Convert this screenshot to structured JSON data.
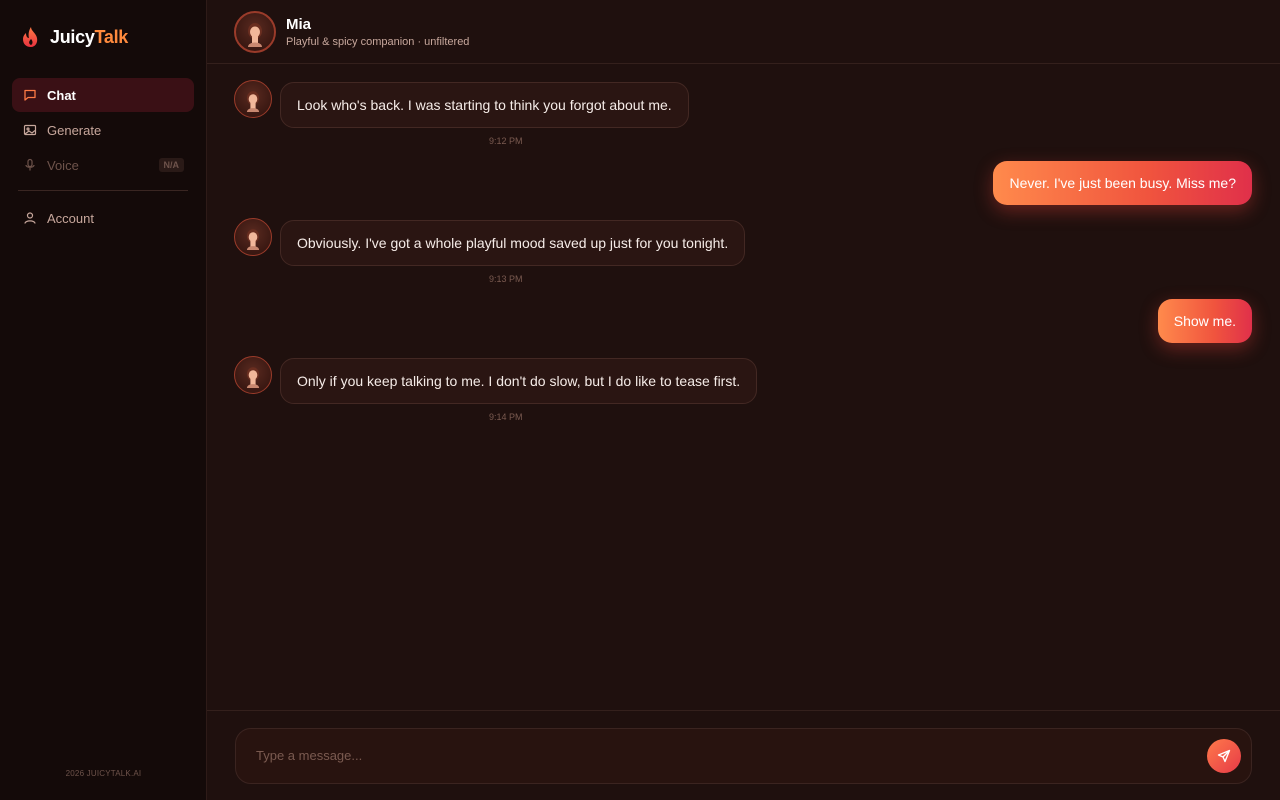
{
  "brand": {
    "name_part1": "Juicy",
    "name_part2": "Talk",
    "accent": "#ff8a3d"
  },
  "sidebar": {
    "items": [
      {
        "label": "Chat",
        "icon": "chat-icon",
        "active": true
      },
      {
        "label": "Generate",
        "icon": "image-icon"
      },
      {
        "label": "Voice",
        "icon": "mic-icon",
        "disabled": true,
        "badge": "N/A"
      },
      {
        "label": "Account",
        "icon": "user-icon"
      }
    ],
    "footer": "2026 JUICYTALK.AI"
  },
  "header": {
    "name": "Mia",
    "subtitle": "Playful & spicy companion · unfiltered"
  },
  "messages": [
    {
      "from": "bot",
      "text": "Look who's back. I was starting to think you forgot about me.",
      "time": "9:12 PM"
    },
    {
      "from": "user",
      "text": "Never. I've just been busy. Miss me?"
    },
    {
      "from": "bot",
      "text": "Obviously. I've got a whole playful mood saved up just for you tonight.",
      "time": "9:13 PM"
    },
    {
      "from": "user",
      "text": "Show me."
    },
    {
      "from": "bot",
      "text": "Only if you keep talking to me. I don't do slow, but I do like to tease first.",
      "time": "9:14 PM"
    }
  ],
  "composer": {
    "placeholder": "Type a message...",
    "send_icon": "send-icon"
  },
  "colors": {
    "user_bubble_start": "#ff8a4c",
    "user_bubble_end": "#e0304a",
    "active_nav": "#3a1015"
  }
}
